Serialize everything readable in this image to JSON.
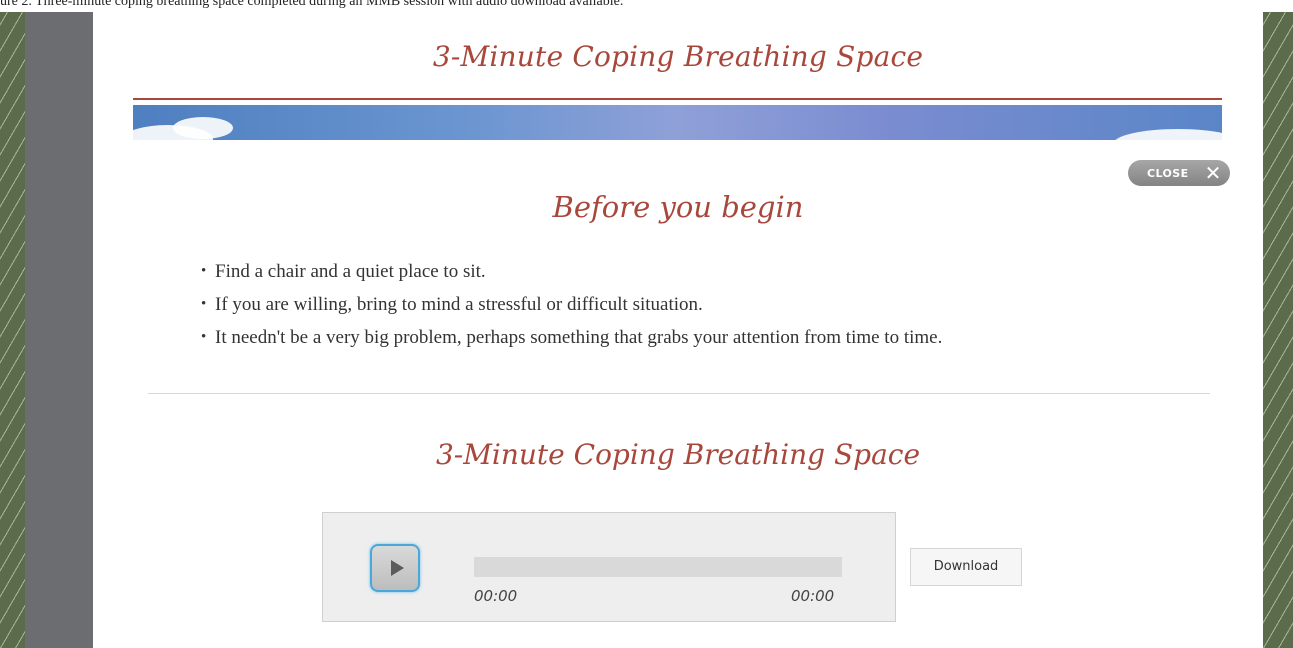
{
  "caption": "ure 2.  Three-minute coping breathing space completed during an MMB session with audio download available.",
  "modal": {
    "title": "3-Minute Coping Breathing Space",
    "close_label": "CLOSE",
    "close_icon": "close-icon"
  },
  "intro": {
    "heading": "Before you begin",
    "bullets": [
      "Find a chair and a quiet place to sit.",
      "If you are willing, bring to mind a stressful or difficult situation.",
      "It needn't be a very big problem, perhaps something that grabs your attention from time to time."
    ]
  },
  "audio": {
    "heading": "3-Minute Coping Breathing Space",
    "current_time": "00:00",
    "total_time": "00:00",
    "progress": 0,
    "play_icon": "play-icon",
    "download_label": "Download"
  },
  "colors": {
    "heading": "#a8473b",
    "side_stripe": "#5c6b4c",
    "side_gray": "#6b6d70",
    "play_outline": "#4aa8d8"
  }
}
